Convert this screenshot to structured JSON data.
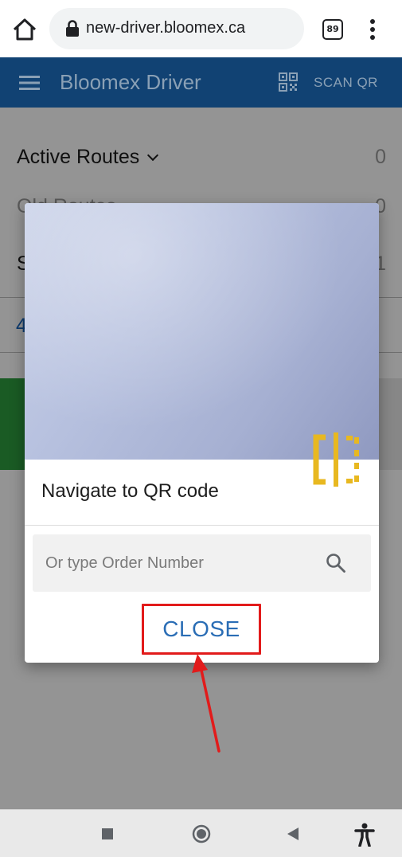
{
  "browser": {
    "url": "new-driver.bloomex.ca",
    "tab_count": "89"
  },
  "app_bar": {
    "title": "Bloomex Driver",
    "scan_label": "SCAN QR"
  },
  "routes": {
    "active_label": "Active Routes",
    "active_count": "0",
    "old_label_partial": "Old Routes",
    "old_count": "0",
    "third_label_partial": "S",
    "third_count": "1",
    "blue_partial": "4"
  },
  "dialog": {
    "title": "Navigate to QR code",
    "search_placeholder": "Or type Order Number",
    "close_label": "CLOSE"
  },
  "colors": {
    "app_bar": "#114273",
    "close_text": "#2a6db5",
    "annotation_red": "#e21b1b",
    "flip_icon": "#e8b820",
    "green_card": "#2e9e3e"
  },
  "icons": [
    "home-icon",
    "lock-icon",
    "tabs-icon",
    "more-vert-icon",
    "menu-icon",
    "qr-code-icon",
    "camera-flip-icon",
    "search-icon",
    "nav-recent-icon",
    "nav-home-icon",
    "nav-back-icon",
    "accessibility-icon"
  ]
}
